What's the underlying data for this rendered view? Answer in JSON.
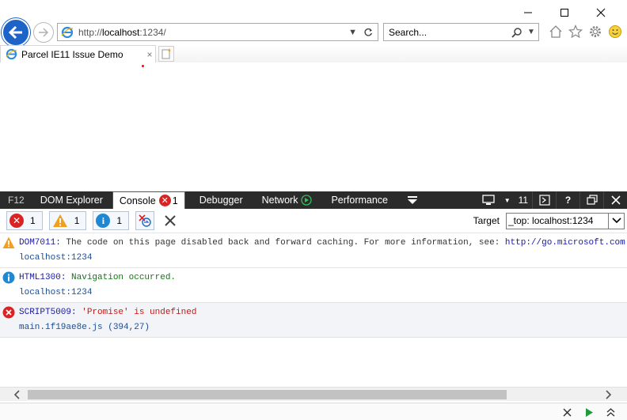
{
  "browser": {
    "address": {
      "protocol": "http://",
      "host": "localhost",
      "rest": ":1234/"
    },
    "search_placeholder": "Search...",
    "tab_title": "Parcel IE11 Issue Demo",
    "tab_close": "×"
  },
  "devtools": {
    "f12_label": "F12",
    "tabs": [
      {
        "label": "DOM Explorer"
      },
      {
        "label": "Console",
        "error_count": "1"
      },
      {
        "label": "Debugger"
      },
      {
        "label": "Network"
      },
      {
        "label": "Performance"
      }
    ],
    "emulation_value": "11",
    "help_label": "?"
  },
  "console": {
    "filters": {
      "errors": "1",
      "warnings": "1",
      "info": "1"
    },
    "target_label": "Target",
    "target_value": "_top: localhost:1234",
    "messages": [
      {
        "level": "warning",
        "code": "DOM7011",
        "sep": ": ",
        "text": "The code on this page disabled back and forward caching. For more information, see: ",
        "link": "http://go.microsoft.com",
        "source": "localhost:1234"
      },
      {
        "level": "info",
        "code": "HTML1300",
        "sep": ": ",
        "text": "Navigation occurred.",
        "source": "localhost:1234"
      },
      {
        "level": "error",
        "code": "SCRIPT5009",
        "sep": ": ",
        "text": "'Promise' is undefined",
        "source": "main.1f19ae8e.js (394,27)"
      }
    ]
  },
  "colors": {
    "error": "#d92424",
    "warning": "#f0a020",
    "info": "#1e88d2",
    "devbar_bg": "#2b2b2b",
    "back_button": "#1e64c8"
  }
}
